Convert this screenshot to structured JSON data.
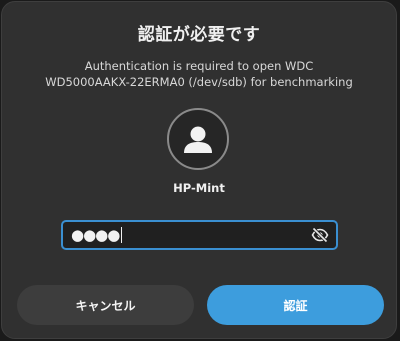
{
  "dialog": {
    "title": "認証が必要です",
    "message_line1": "Authentication is required to open WDC",
    "message_line2": "WD5000AAKX-22ERMA0 (/dev/sdb) for benchmarking"
  },
  "user": {
    "avatar_icon": "user-avatar-icon",
    "name": "HP-Mint"
  },
  "password": {
    "masked_value": "●●●●",
    "visibility_icon": "eye-off-icon"
  },
  "buttons": {
    "cancel_label": "キャンセル",
    "authenticate_label": "認証"
  },
  "colors": {
    "dialog_bg": "#303030",
    "accent": "#3d9ddd",
    "focus_border": "#3a8fd1",
    "secondary_button": "#3d3d3d"
  }
}
